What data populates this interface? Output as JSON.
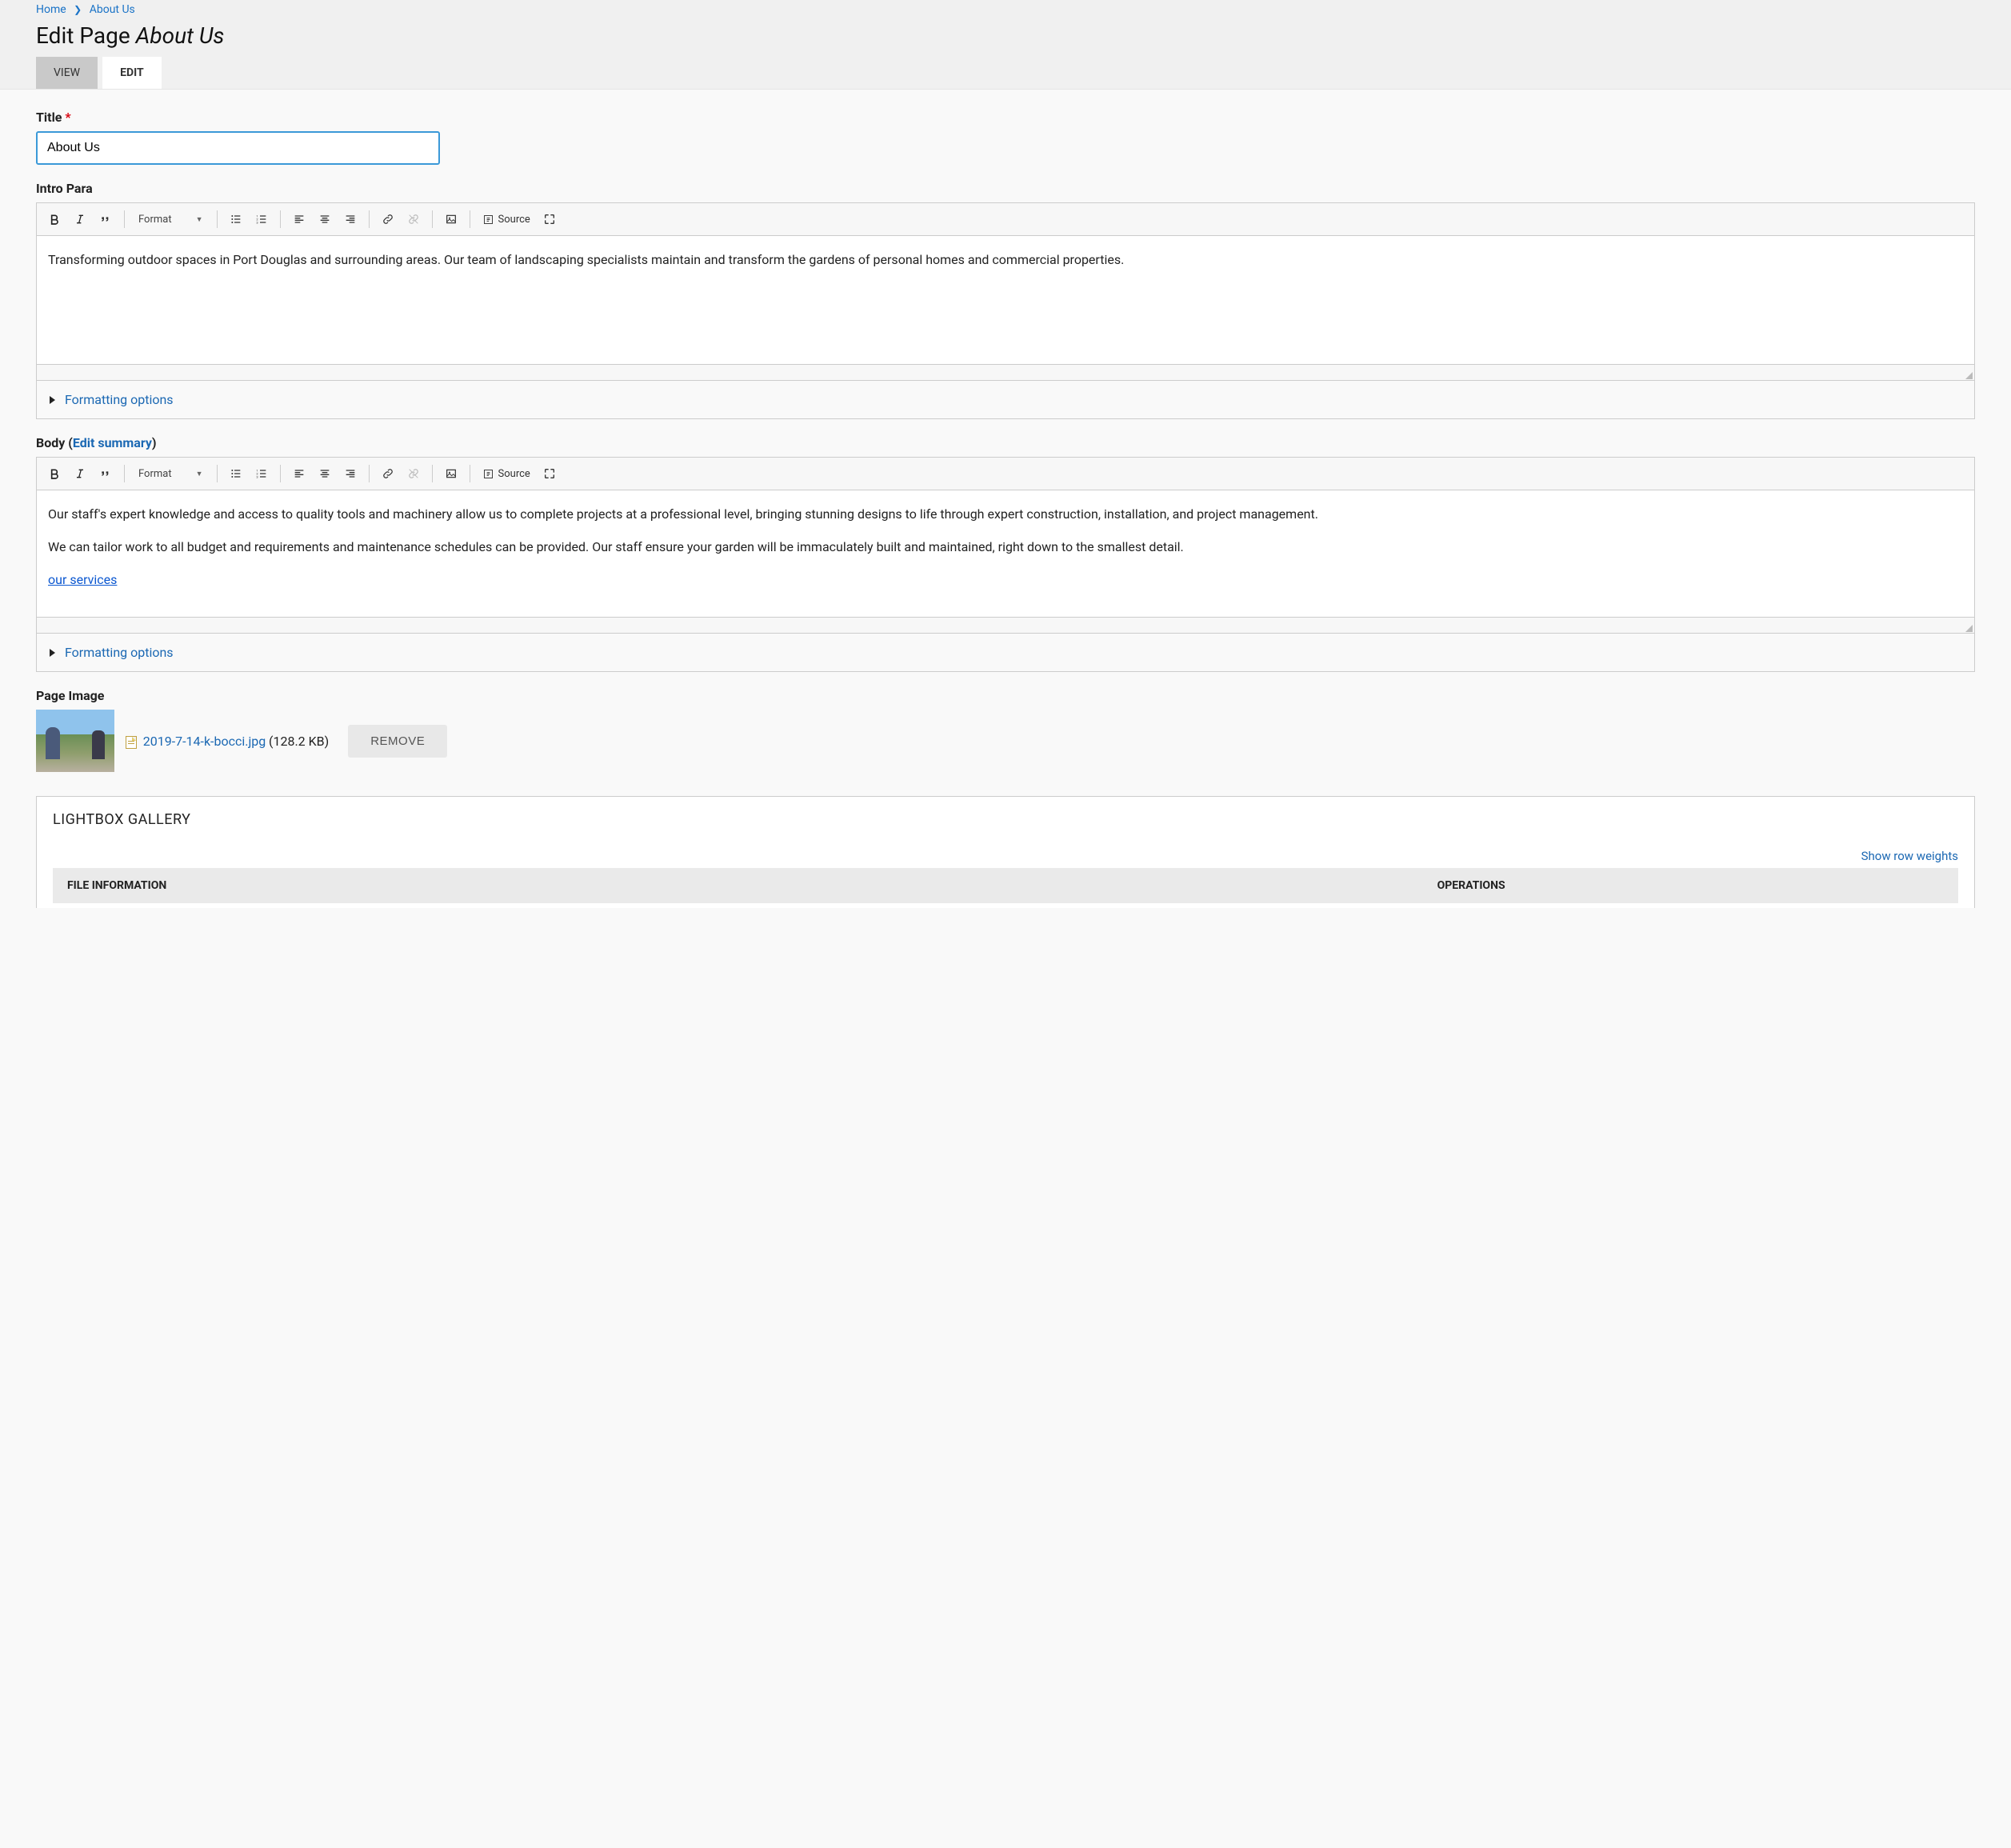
{
  "breadcrumb": [
    {
      "label": "Home"
    },
    {
      "label": "About Us"
    }
  ],
  "page_heading": {
    "prefix": "Edit Page ",
    "em": "About Us"
  },
  "tabs": {
    "view": "VIEW",
    "edit": "EDIT"
  },
  "title_field": {
    "label": "Title",
    "required": "*",
    "value": "About Us"
  },
  "intro": {
    "label": "Intro Para",
    "content": "Transforming outdoor spaces in Port Douglas and surrounding areas. Our team of landscaping specialists maintain and transform the gardens of personal homes and commercial properties."
  },
  "toolbar": {
    "format_label": "Format",
    "source_label": "Source"
  },
  "formatting_options_label": "Formatting options",
  "body": {
    "label_prefix": "Body (",
    "edit_summary": "Edit summary",
    "label_suffix": ")",
    "p1": "Our staff's expert knowledge and access to quality tools and machinery allow us to complete projects at a professional level, bringing stunning designs to life through expert construction, installation, and project management.",
    "p2": "We can tailor work to all budget and requirements and maintenance schedules can be provided. Our staff ensure your garden will be immaculately built and maintained, right down to the smallest detail.",
    "link_text": "our services"
  },
  "page_image": {
    "label": "Page Image",
    "filename": "2019-7-14-k-bocci.jpg",
    "size": "(128.2 KB)",
    "remove_label": "REMOVE"
  },
  "gallery": {
    "title": "LIGHTBOX GALLERY",
    "row_weights": "Show row weights",
    "col_file": "FILE INFORMATION",
    "col_ops": "OPERATIONS"
  }
}
